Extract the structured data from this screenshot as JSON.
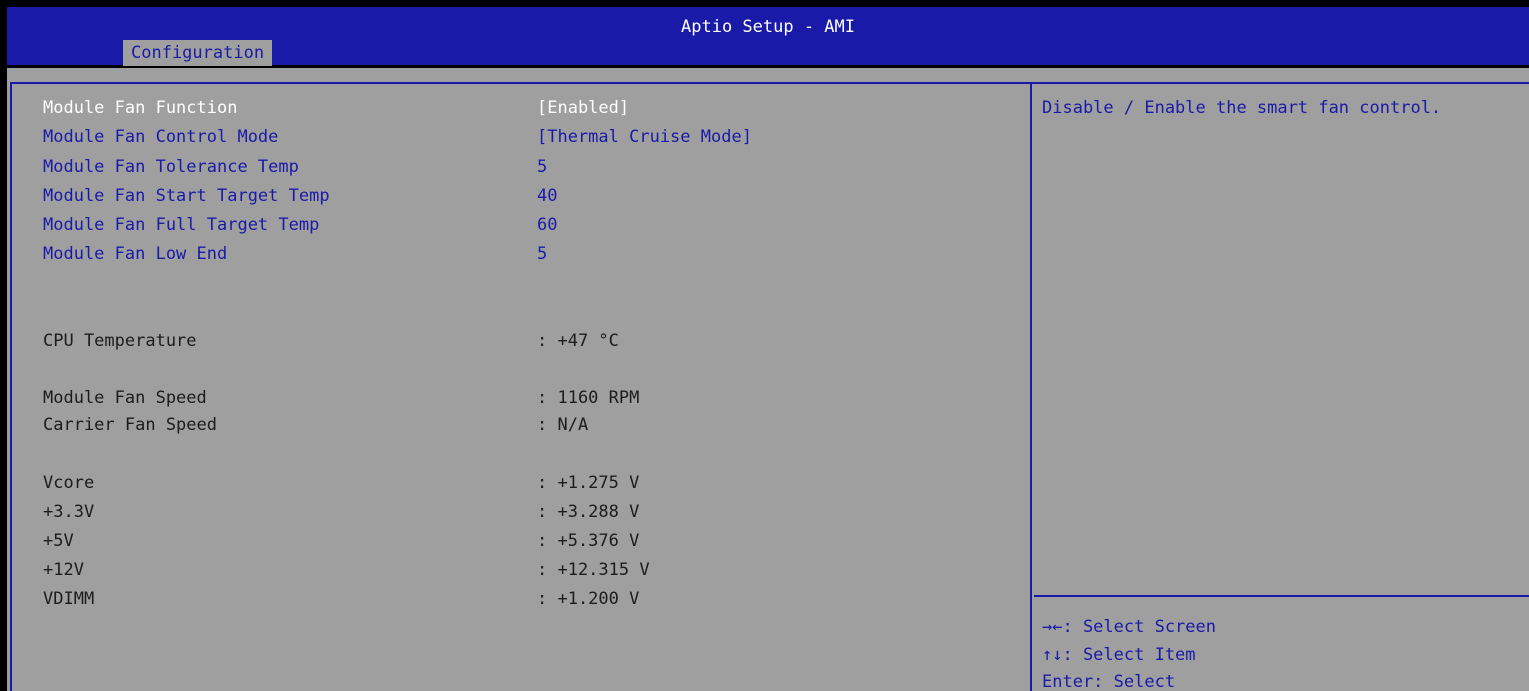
{
  "title": "Aptio Setup - AMI",
  "tabs": [
    {
      "label": "Configuration"
    }
  ],
  "settings": [
    {
      "label": "Module Fan Function",
      "value": "[Enabled]"
    },
    {
      "label": "Module Fan Control Mode",
      "value": "[Thermal Cruise Mode]"
    },
    {
      "label": "Module Fan Tolerance Temp",
      "value": "5"
    },
    {
      "label": "Module Fan Start Target Temp",
      "value": "40"
    },
    {
      "label": "Module Fan Full Target Temp",
      "value": "60"
    },
    {
      "label": "Module Fan Low End",
      "value": "5"
    }
  ],
  "readings": [
    {
      "label": "CPU Temperature",
      "value": ": +47 °C"
    },
    {
      "label": "Module Fan Speed",
      "value": ": 1160 RPM"
    },
    {
      "label": "Carrier Fan Speed",
      "value": ": N/A"
    },
    {
      "label": "Vcore",
      "value": ": +1.275 V"
    },
    {
      "label": "+3.3V",
      "value": ": +3.288 V"
    },
    {
      "label": "+5V",
      "value": ": +5.376 V"
    },
    {
      "label": "+12V",
      "value": ": +12.315 V"
    },
    {
      "label": "VDIMM",
      "value": ": +1.200 V"
    }
  ],
  "help": {
    "text": "Disable / Enable the smart fan control."
  },
  "keys": [
    {
      "label": "→←: Select Screen"
    },
    {
      "label": "↑↓: Select Item"
    },
    {
      "label": "Enter: Select"
    }
  ],
  "colors": {
    "title_bar": "#1a1aa8",
    "background": "#9f9f9f",
    "selected_text": "#ffffff",
    "option_text": "#1a1aa8",
    "info_text": "#1c1c1c"
  }
}
